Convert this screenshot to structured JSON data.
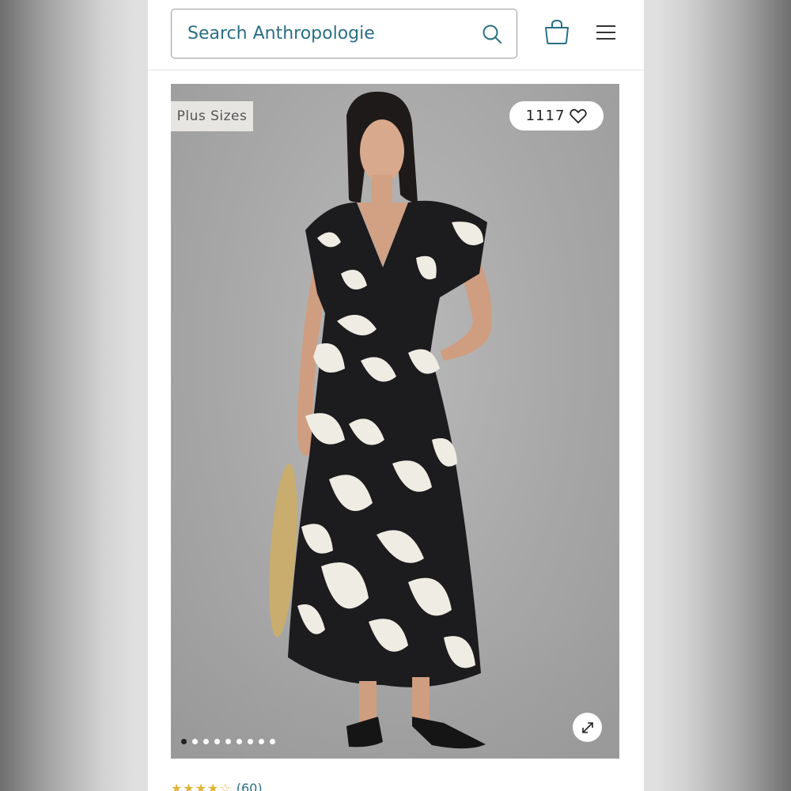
{
  "header": {
    "search": {
      "placeholder": "Search Anthropologie",
      "icon": "search-icon"
    },
    "bag_icon": "shopping-bag-icon",
    "menu_icon": "hamburger-menu-icon"
  },
  "product": {
    "badge": "Plus Sizes",
    "favorites_count": "1117",
    "favorite_icon": "heart-icon",
    "expand_icon": "expand-icon",
    "carousel": {
      "total_slides": 9,
      "active_index": 0
    },
    "rating": {
      "stars": "★★★★☆",
      "reviews": "(60)"
    }
  },
  "colors": {
    "accent": "#2a6f84",
    "star": "#e0b43a",
    "badge_bg": "#e7e5e2"
  }
}
